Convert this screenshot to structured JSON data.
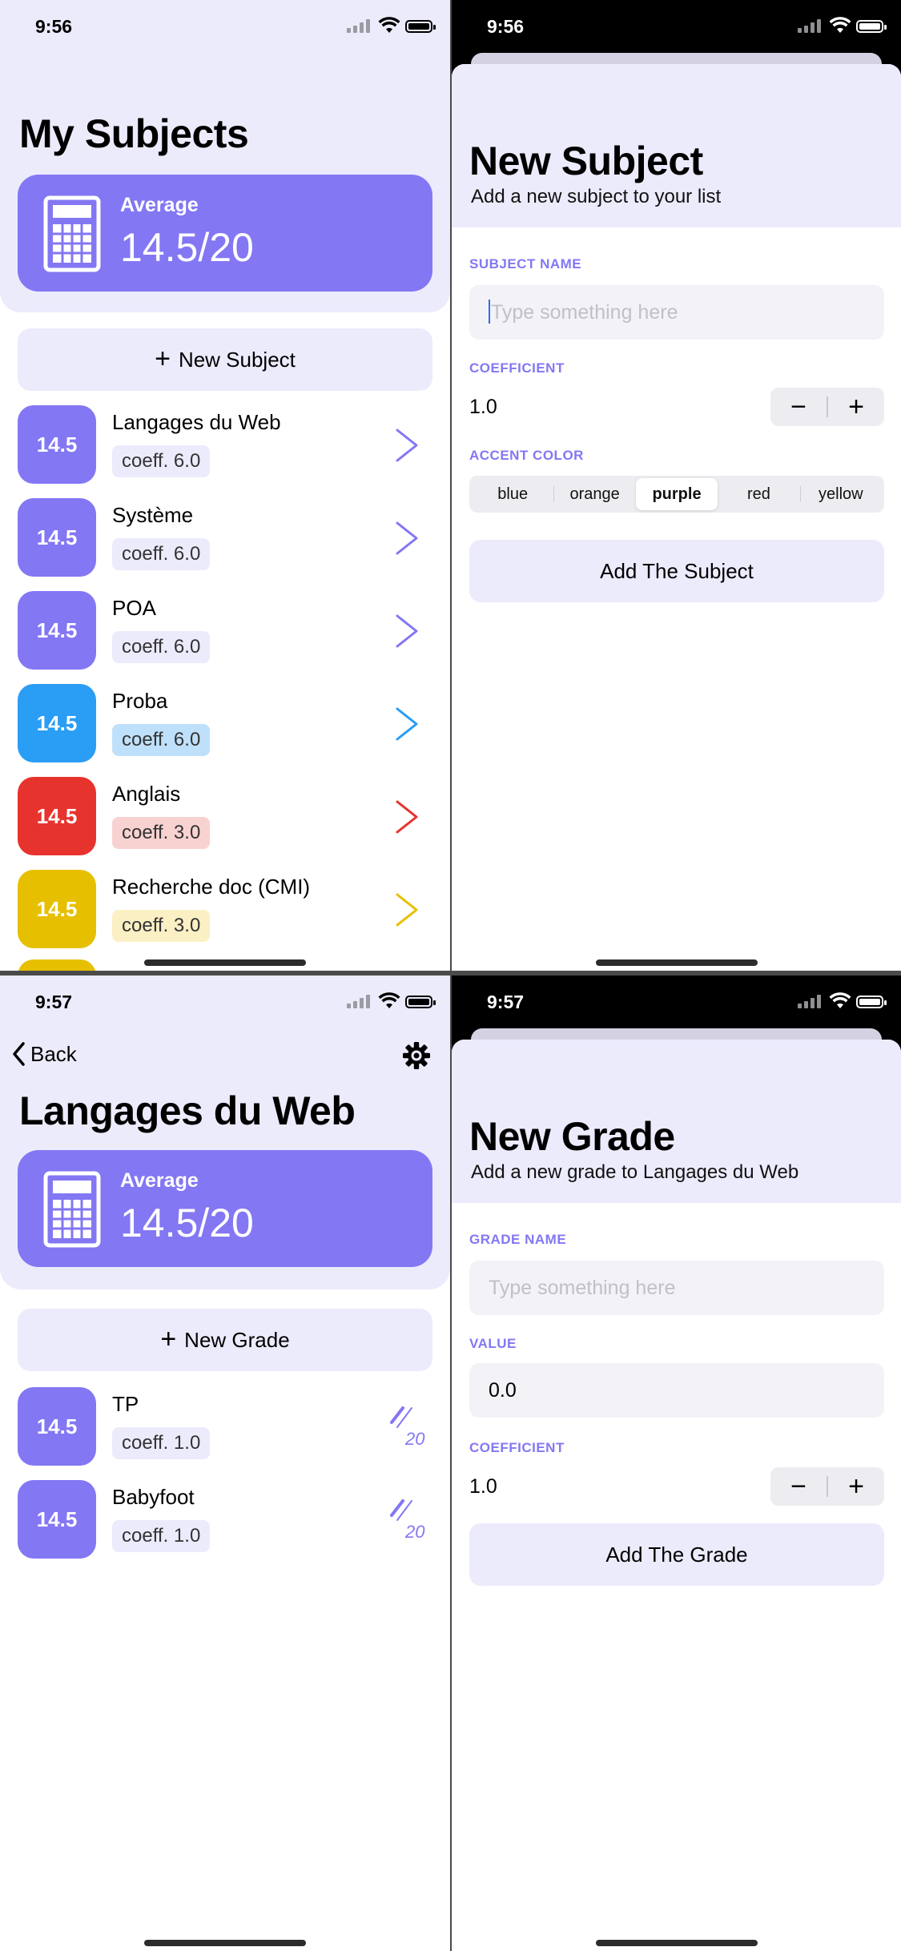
{
  "colors": {
    "purple": "#8377f3",
    "blue": "#2a9df4",
    "red": "#e7332e",
    "yellow": "#e6c000",
    "accent_light": "#ecebfc"
  },
  "subjects_screen": {
    "time": "9:56",
    "title": "My Subjects",
    "average_label": "Average",
    "average_value": "14.5/20",
    "new_button": "New Subject",
    "subjects": [
      {
        "grade": "14.5",
        "name": "Langages du Web",
        "coef": "coeff. 6.0",
        "color": "purple"
      },
      {
        "grade": "14.5",
        "name": "Système",
        "coef": "coeff. 6.0",
        "color": "purple"
      },
      {
        "grade": "14.5",
        "name": "POA",
        "coef": "coeff. 6.0",
        "color": "purple"
      },
      {
        "grade": "14.5",
        "name": "Proba",
        "coef": "coeff. 6.0",
        "color": "blue"
      },
      {
        "grade": "14.5",
        "name": "Anglais",
        "coef": "coeff. 3.0",
        "color": "red"
      },
      {
        "grade": "14.5",
        "name": "Recherche doc (CMI)",
        "coef": "coeff. 3.0",
        "color": "yellow"
      }
    ]
  },
  "new_subject_sheet": {
    "time": "9:56",
    "title": "New Subject",
    "subtitle": "Add a new subject to your list",
    "name_label": "SUBJECT NAME",
    "name_placeholder": "Type something here",
    "coef_label": "COEFFICIENT",
    "coef_value": "1.0",
    "minus": "−",
    "plus": "+",
    "color_label": "ACCENT COLOR",
    "color_options": [
      "blue",
      "orange",
      "purple",
      "red",
      "yellow"
    ],
    "selected_color": "purple",
    "submit": "Add The Subject"
  },
  "grades_screen": {
    "time": "9:57",
    "back": "Back",
    "title": "Langages du Web",
    "average_label": "Average",
    "average_value": "14.5/20",
    "new_button": "New Grade",
    "grades": [
      {
        "grade": "14.5",
        "name": "TP",
        "coef": "coeff. 1.0"
      },
      {
        "grade": "14.5",
        "name": "Babyfoot",
        "coef": "coeff. 1.0"
      }
    ]
  },
  "new_grade_sheet": {
    "time": "9:57",
    "title": "New Grade",
    "subtitle": "Add a new grade to Langages du Web",
    "name_label": "GRADE NAME",
    "name_placeholder": "Type something here",
    "value_label": "VALUE",
    "value": "0.0",
    "coef_label": "COEFFICIENT",
    "coef_value": "1.0",
    "minus": "−",
    "plus": "+",
    "submit": "Add The Grade"
  }
}
